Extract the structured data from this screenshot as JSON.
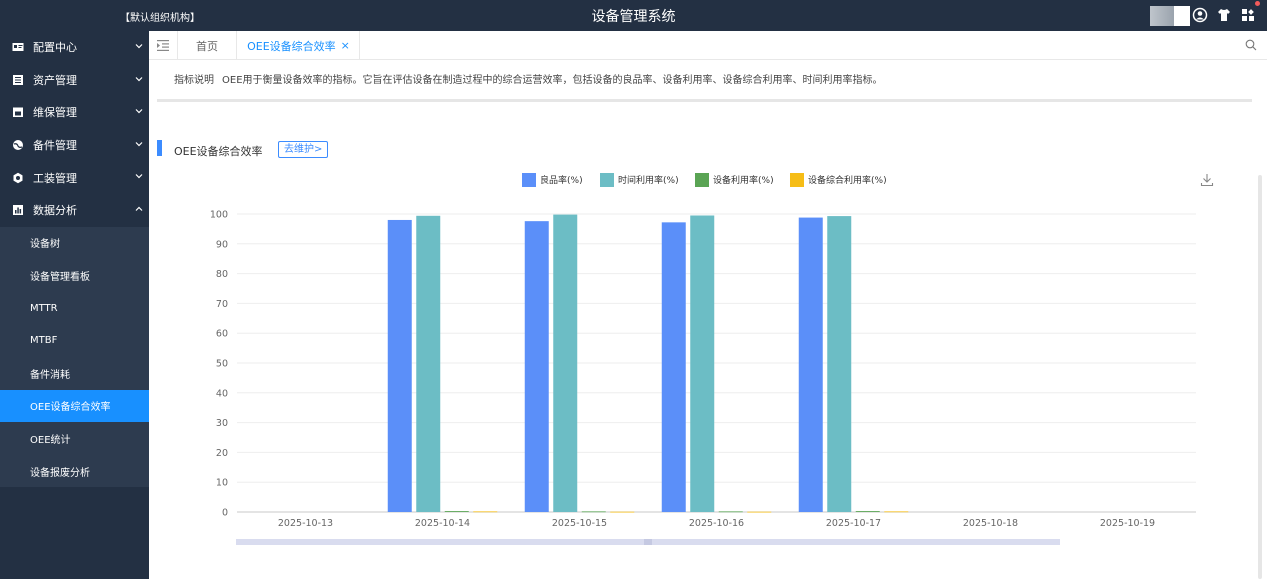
{
  "header": {
    "org": "【默认组织机构】",
    "title": "设备管理系统"
  },
  "sidebar": {
    "items": [
      {
        "label": "配置中心",
        "icon": "id-card-icon",
        "expanded": false
      },
      {
        "label": "资产管理",
        "icon": "list-icon",
        "expanded": false
      },
      {
        "label": "维保管理",
        "icon": "calendar-icon",
        "expanded": false
      },
      {
        "label": "备件管理",
        "icon": "globe-icon",
        "expanded": false
      },
      {
        "label": "工装管理",
        "icon": "tool-icon",
        "expanded": false
      },
      {
        "label": "数据分析",
        "icon": "bar-chart-icon",
        "expanded": true
      }
    ],
    "submenu": [
      "设备树",
      "设备管理看板",
      "MTTR",
      "MTBF",
      "备件消耗",
      "OEE设备综合效率",
      "OEE统计",
      "设备报废分析"
    ],
    "active_sub": "OEE设备综合效率"
  },
  "tabs": {
    "home": "首页",
    "active": "OEE设备综合效率",
    "close": "×"
  },
  "indicator": {
    "label": "指标说明",
    "text": "OEE用于衡量设备效率的指标。它旨在评估设备在制造过程中的综合运营效率，包括设备的良品率、设备利用率、设备综合利用率、时间利用率指标。"
  },
  "section": {
    "title": "OEE设备综合效率",
    "button": "去维护>"
  },
  "colors": {
    "accent": "#1890ff",
    "sidebar_bg": "#233043"
  },
  "chart_data": {
    "type": "bar",
    "categories": [
      "2025-10-13",
      "2025-10-14",
      "2025-10-15",
      "2025-10-16",
      "2025-10-17",
      "2025-10-18",
      "2025-10-19"
    ],
    "series": [
      {
        "name": "良品率(%)",
        "color": "#5b8ff9",
        "values": [
          null,
          98,
          97.6,
          97.2,
          98.8,
          null,
          null
        ]
      },
      {
        "name": "时间利用率(%)",
        "color": "#6cbdc5",
        "values": [
          null,
          99.4,
          99.8,
          99.5,
          99.3,
          null,
          null
        ]
      },
      {
        "name": "设备利用率(%)",
        "color": "#5aa454",
        "values": [
          null,
          0.3,
          0.2,
          0.2,
          0.3,
          null,
          null
        ]
      },
      {
        "name": "设备综合利用率(%)",
        "color": "#f6bd16",
        "values": [
          null,
          0.2,
          0.1,
          0.1,
          0.2,
          null,
          null
        ]
      }
    ],
    "yticks": [
      0,
      10,
      20,
      30,
      40,
      50,
      60,
      70,
      80,
      90,
      100
    ],
    "ylim": [
      0,
      100
    ],
    "legend": "top-center",
    "grid": true
  }
}
